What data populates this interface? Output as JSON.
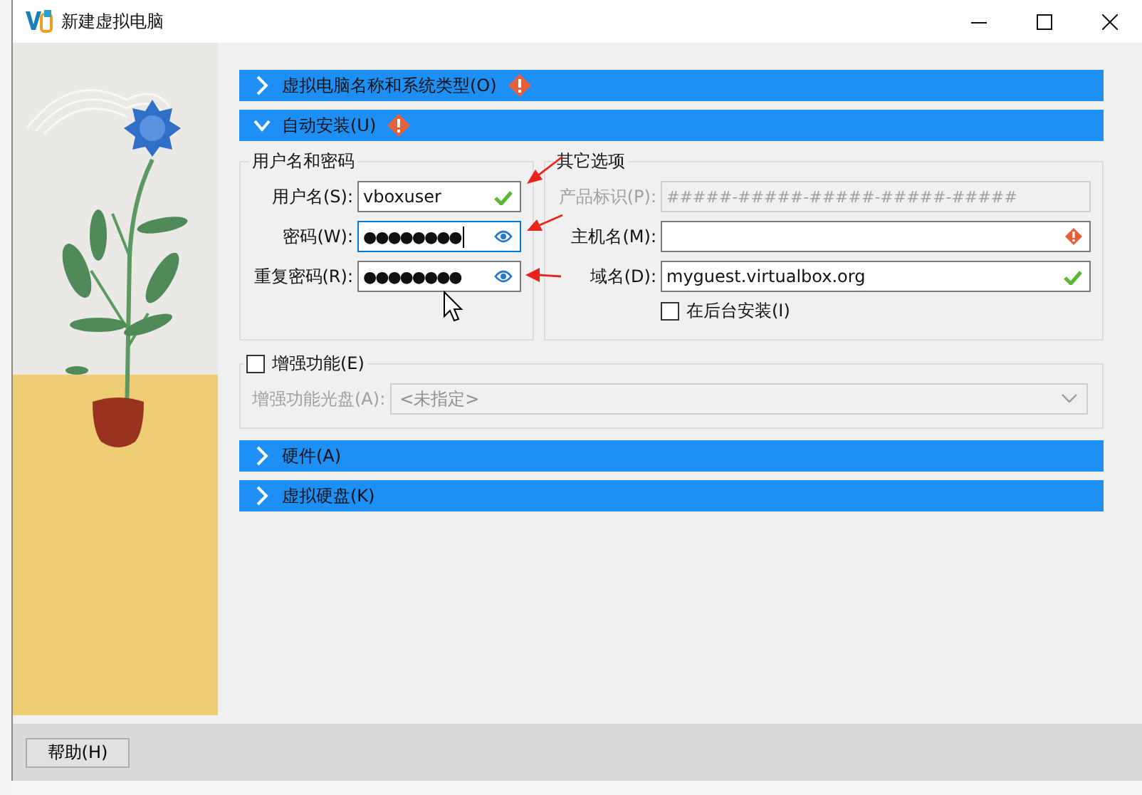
{
  "window": {
    "title": "新建虚拟电脑"
  },
  "sections": [
    {
      "kind": "name_os",
      "title": "虚拟电脑名称和系统类型(O)",
      "expanded": false,
      "warning": true
    },
    {
      "kind": "unattended",
      "title": "自动安装(U)",
      "expanded": true,
      "warning": true,
      "content": {
        "credentials": {
          "title": "用户名和密码",
          "fields": [
            {
              "label": "用户名(S):",
              "kind": "text",
              "value": "vboxuser",
              "valid": true,
              "focused": false
            },
            {
              "label": "密码(W):",
              "kind": "password",
              "value": "●●●●●●●●",
              "focused": true
            },
            {
              "label": "重复密码(R):",
              "kind": "password",
              "value": "●●●●●●●●",
              "focused": false
            }
          ]
        },
        "other_options": {
          "title": "其它选项",
          "fields": [
            {
              "label": "产品标识(P):",
              "placeholder": "#####-#####-#####-#####-#####",
              "disabled": true
            },
            {
              "label": "主机名(M):",
              "valid": false,
              "disabled": false
            },
            {
              "label": "域名(D):",
              "value": "myguest.virtualbox.org",
              "valid": true,
              "disabled": false
            }
          ],
          "background_install": {
            "label": "在后台安装(I)",
            "checked": false
          }
        },
        "guest_additions": {
          "label": "增强功能(E)",
          "checked": false,
          "iso": {
            "label": "增强功能光盘(A):",
            "value": "<未指定>"
          }
        }
      }
    },
    {
      "kind": "hardware",
      "title": "硬件(A)",
      "expanded": false,
      "warning": false
    },
    {
      "kind": "disk",
      "title": "虚拟硬盘(K)",
      "expanded": false,
      "warning": false
    }
  ],
  "help_button": "帮助(H)"
}
